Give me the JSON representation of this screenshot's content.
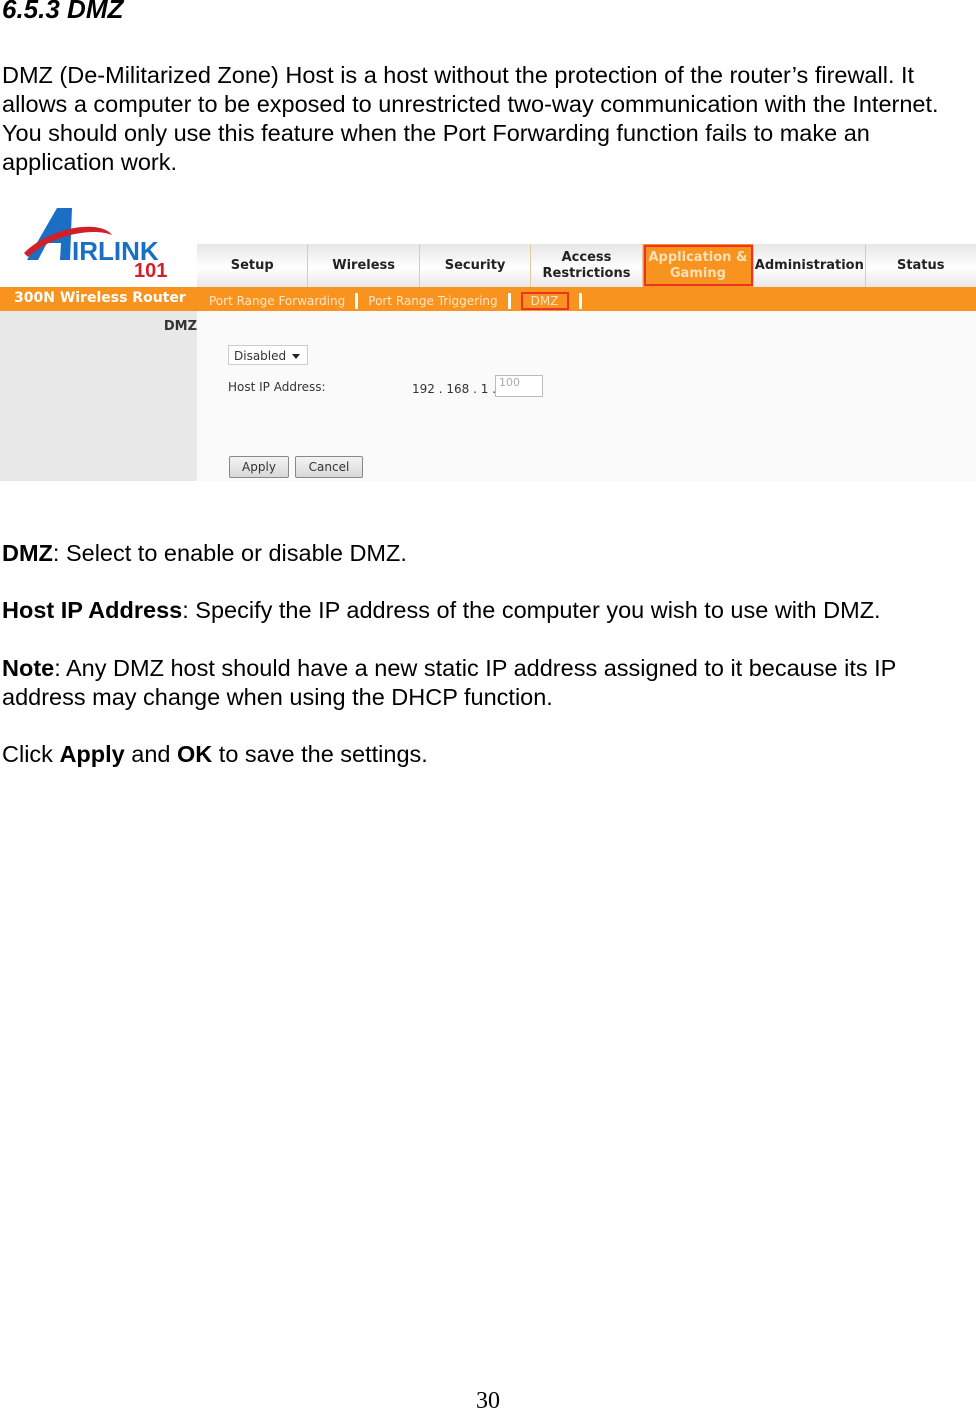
{
  "heading": "6.5.3 DMZ",
  "intro": "DMZ (De-Militarized Zone) Host is a host without the protection of the router’s firewall. It allows a computer to be exposed to unrestricted two-way communication with the Internet. You should only use this feature when the Port Forwarding function fails to make an application work.",
  "router": {
    "logo_text": "AIRLINK 101",
    "brand": "300N Wireless Router",
    "tabs": [
      "Setup",
      "Wireless",
      "Security",
      "Access Restrictions",
      "Application & Gaming",
      "Administration",
      "Status"
    ],
    "active_tab": "Application & Gaming",
    "subtabs": [
      "Port Range Forwarding",
      "Port Range Triggering",
      "DMZ"
    ],
    "section": "DMZ",
    "dmz_select": "Disabled",
    "host_ip_label": "Host IP Address:",
    "ip_prefix": "192 . 168 . 1 .",
    "ip_last_placeholder": "100",
    "apply": "Apply",
    "cancel": "Cancel",
    "highlight_color": "#e32222",
    "accent_color": "#f7931e"
  },
  "defs": [
    {
      "term": "DMZ",
      "text": ": Select to enable or disable DMZ."
    },
    {
      "term": "Host IP Address",
      "text": ": Specify the IP address of the computer you wish to use with DMZ."
    },
    {
      "term": "Note",
      "text": ": Any DMZ host should have a new static IP address assigned to it because its IP address may change when using the DHCP function."
    }
  ],
  "click": {
    "a": "Click ",
    "b": "Apply",
    "c": " and ",
    "d": "OK",
    "e": " to save the settings."
  },
  "page_number": "30"
}
